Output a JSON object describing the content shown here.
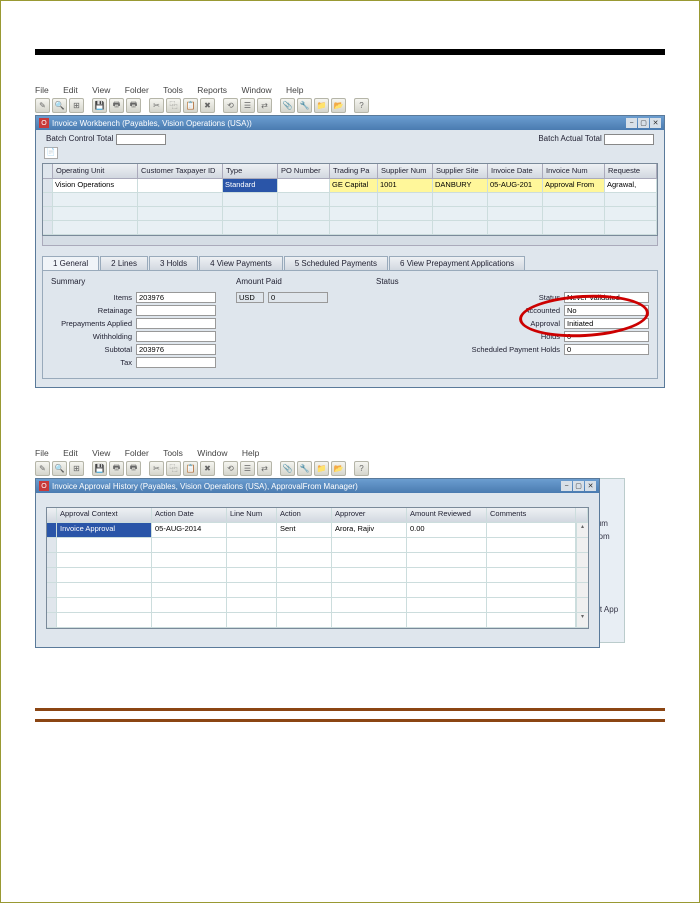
{
  "menu1": [
    "File",
    "Edit",
    "View",
    "Folder",
    "Tools",
    "Reports",
    "Window",
    "Help"
  ],
  "menu2": [
    "File",
    "Edit",
    "View",
    "Folder",
    "Tools",
    "Window",
    "Help"
  ],
  "window1": {
    "title": "Invoice Workbench (Payables, Vision Operations (USA))",
    "batch_control_label": "Batch Control Total",
    "batch_actual_label": "Batch Actual Total"
  },
  "grid1": {
    "cols": [
      "Operating Unit",
      "Customer Taxpayer ID",
      "Type",
      "PO Number",
      "Trading Pa",
      "Supplier Num",
      "Supplier Site",
      "Invoice Date",
      "Invoice Num",
      "Requeste"
    ],
    "row": {
      "op_unit": "Vision Operations",
      "taxpayer": "",
      "type": "Standard",
      "po": "",
      "trading": "GE Capital",
      "supnum": "1001",
      "supsite": "DANBURY",
      "invdate": "05-AUG-201",
      "invnum": "Approval From",
      "requeste": "Agrawal, "
    }
  },
  "tabs": [
    "1 General",
    "2 Lines",
    "3 Holds",
    "4 View Payments",
    "5 Scheduled Payments",
    "6 View Prepayment Applications"
  ],
  "summary": {
    "title": "Summary",
    "items_label": "Items",
    "items_val": "203976",
    "retainage_label": "Retainage",
    "prepay_label": "Prepayments Applied",
    "withholding_label": "Withholding",
    "subtotal_label": "Subtotal",
    "subtotal_val": "203976",
    "tax_label": "Tax"
  },
  "amount_paid": {
    "title": "Amount Paid",
    "curr": "USD",
    "val": "0"
  },
  "status": {
    "title": "Status",
    "status_label": "Status",
    "status_val": "Never Validated",
    "accounted_label": "Accounted",
    "accounted_val": "No",
    "approval_label": "Approval",
    "approval_val": "Initiated",
    "holds_label": "Holds",
    "holds_val": "0",
    "sph_label": "Scheduled Payment Holds",
    "sph_val": "0"
  },
  "window2": {
    "title": "Invoice Approval History (Payables, Vision Operations (USA), ApprovalFrom Manager)"
  },
  "grid2": {
    "cols": [
      "Approval Context",
      "Action Date",
      "Line Num",
      "Action",
      "Approver",
      "Amount Reviewed",
      "Comments"
    ],
    "row": {
      "context": "Invoice Approval",
      "date": "05-AUG-2014",
      "linenum": "",
      "action": "Sent",
      "approver": "Arora, Rajiv",
      "amount": "0.00",
      "comments": ""
    }
  },
  "sidefrag": {
    "num": "Num",
    "from": "From",
    "app": "ent App"
  }
}
